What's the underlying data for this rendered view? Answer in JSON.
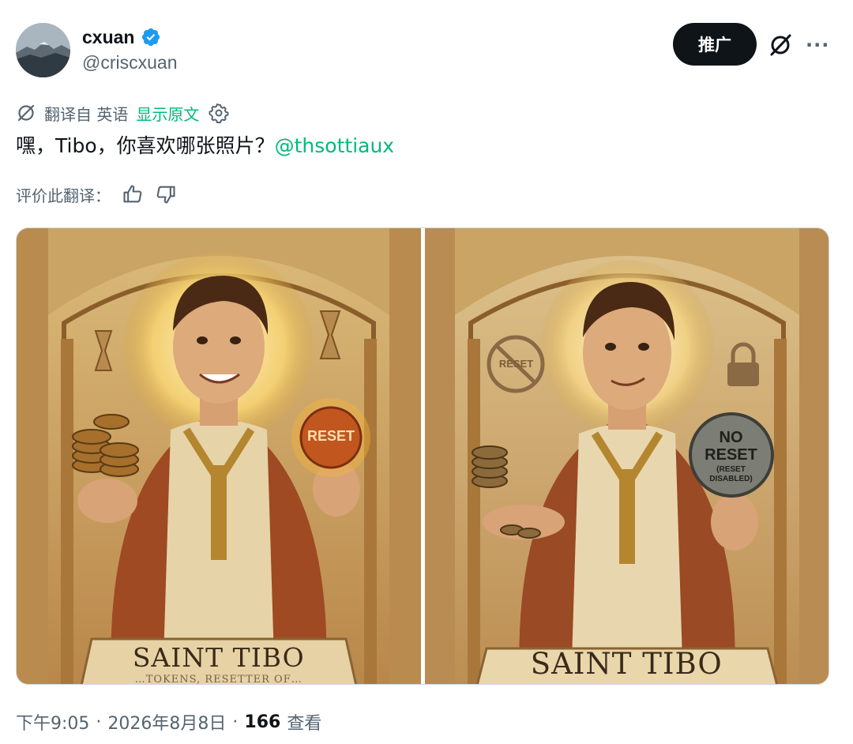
{
  "author": {
    "display_name": "cxuan",
    "handle": "@criscxuan",
    "verified_icon": "verified-badge-icon"
  },
  "header": {
    "promote_label": "推广",
    "grok_icon": "grok-slash-icon",
    "more_icon": "more-icon",
    "more_glyph": "···"
  },
  "translation": {
    "label": "翻译自 英语",
    "show_original": "显示原文"
  },
  "tweet": {
    "text": "嘿，Tibo，你喜欢哪张照片？",
    "mention": "@thsottiaux"
  },
  "rating": {
    "label": "评价此翻译："
  },
  "media": {
    "card1": {
      "title": "SAINT TIBO",
      "subtitle": "…TOKENS, RESETTER OF…",
      "coin_label": "RESET"
    },
    "card2": {
      "title": "SAINT TIBO",
      "sign_label": "RESET",
      "coin_line1": "NO",
      "coin_line2": "RESET",
      "coin_line3": "(RESET",
      "coin_line4": "DISABLED)"
    }
  },
  "meta": {
    "time": "下午9:05",
    "sep1": "·",
    "date": "2026年8月8日",
    "sep2": "·",
    "views_count": "166",
    "views_label": "查看"
  },
  "colors": {
    "accent_green": "#00ba7c",
    "verified_blue": "#1d9bf0",
    "text_primary": "#0f1419",
    "text_secondary": "#536471"
  }
}
